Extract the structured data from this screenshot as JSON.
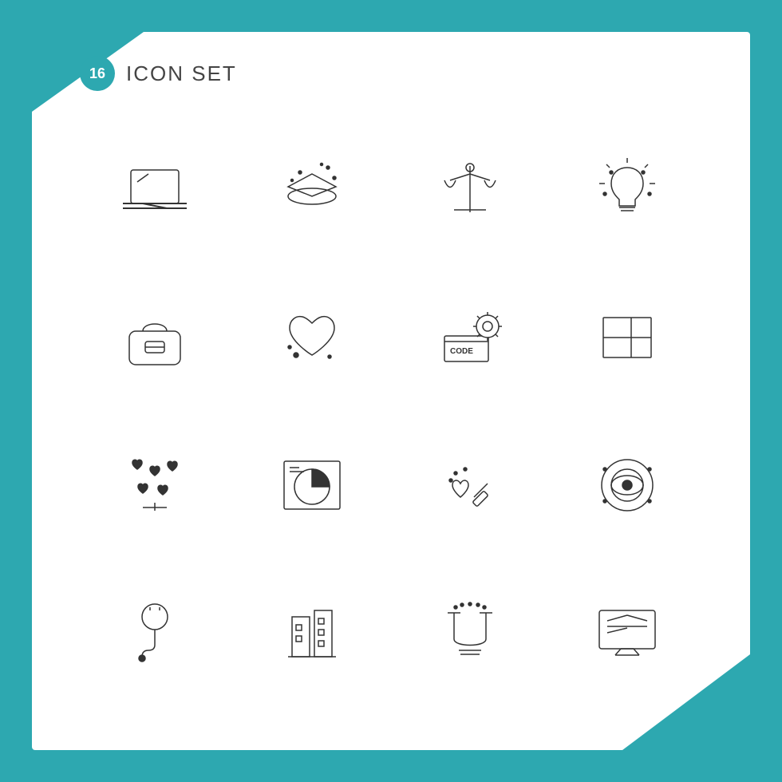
{
  "header": {
    "badge": "16",
    "title": "ICON SET"
  },
  "icons": [
    {
      "name": "laptop-icon",
      "label": "Laptop"
    },
    {
      "name": "layers-icon",
      "label": "Layers / AR"
    },
    {
      "name": "justice-scale-icon",
      "label": "Justice Scale"
    },
    {
      "name": "lightbulb-icon",
      "label": "Light Bulb"
    },
    {
      "name": "handbag-icon",
      "label": "Handbag"
    },
    {
      "name": "heart-bandage-icon",
      "label": "Heart Bandage"
    },
    {
      "name": "code-settings-icon",
      "label": "Code Settings"
    },
    {
      "name": "grid-layout-icon",
      "label": "Grid Layout"
    },
    {
      "name": "hearts-falling-icon",
      "label": "Hearts Falling"
    },
    {
      "name": "pie-chart-icon",
      "label": "Pie Chart"
    },
    {
      "name": "love-edit-icon",
      "label": "Love Edit"
    },
    {
      "name": "eye-target-icon",
      "label": "Eye Target"
    },
    {
      "name": "plug-icon",
      "label": "Plug"
    },
    {
      "name": "buildings-icon",
      "label": "Buildings"
    },
    {
      "name": "magnet-icon",
      "label": "Magnet"
    },
    {
      "name": "monitor-icon",
      "label": "Monitor"
    }
  ]
}
